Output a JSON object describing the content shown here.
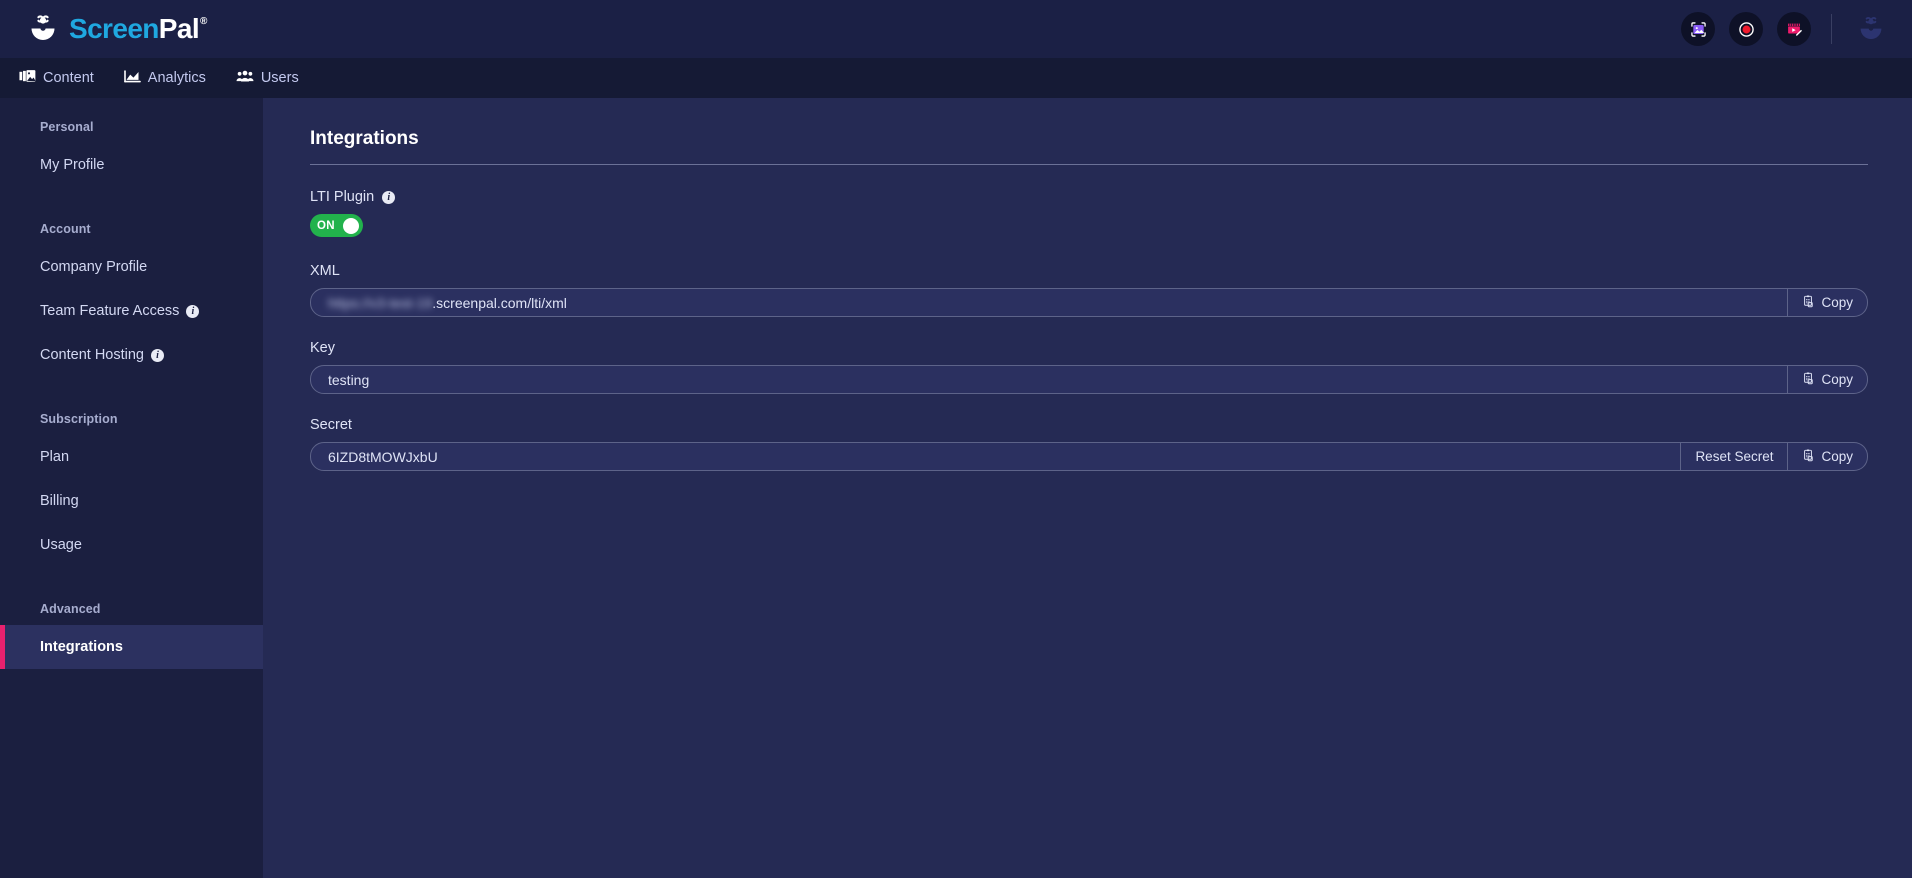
{
  "brand": {
    "logo_screen": "Screen",
    "logo_pal": "Pal",
    "logo_reg": "®",
    "accent_pink": "#e8216e",
    "accent_blue": "#1fa8e0",
    "toggle_green": "#22b24c"
  },
  "topbar": {
    "actions": [
      {
        "name": "screenshot-button",
        "icon": "image-capture-icon"
      },
      {
        "name": "record-button",
        "icon": "record-circle-icon"
      },
      {
        "name": "video-editor-button",
        "icon": "video-editor-icon"
      }
    ],
    "avatar_icon": "user-avatar-icon"
  },
  "nav": {
    "items": [
      {
        "label": "Content",
        "icon": "content-images-icon"
      },
      {
        "label": "Analytics",
        "icon": "analytics-chart-icon"
      },
      {
        "label": "Users",
        "icon": "users-group-icon"
      }
    ]
  },
  "sidebar": {
    "groups": [
      {
        "title": "Personal",
        "items": [
          {
            "label": "My Profile",
            "info": false,
            "active": false
          }
        ]
      },
      {
        "title": "Account",
        "items": [
          {
            "label": "Company Profile",
            "info": false,
            "active": false
          },
          {
            "label": "Team Feature Access",
            "info": true,
            "active": false
          },
          {
            "label": "Content Hosting",
            "info": true,
            "active": false
          }
        ]
      },
      {
        "title": "Subscription",
        "items": [
          {
            "label": "Plan",
            "info": false,
            "active": false
          },
          {
            "label": "Billing",
            "info": false,
            "active": false
          },
          {
            "label": "Usage",
            "info": false,
            "active": false
          }
        ]
      },
      {
        "title": "Advanced",
        "items": [
          {
            "label": "Integrations",
            "info": false,
            "active": true
          }
        ]
      }
    ],
    "info_glyph": "i"
  },
  "main": {
    "title": "Integrations",
    "lti": {
      "label": "LTI Plugin",
      "info_icon": "info-icon",
      "toggle_state": "ON",
      "toggle_on": true
    },
    "fields": [
      {
        "label": "XML",
        "value_redacted": "https://v3-test-19",
        "value": ".screenpal.com/lti/xml",
        "has_reset": false,
        "copy_label": "Copy"
      },
      {
        "label": "Key",
        "value_redacted": "",
        "value": "testing",
        "has_reset": false,
        "copy_label": "Copy"
      },
      {
        "label": "Secret",
        "value_redacted": "",
        "value": "6IZD8tMOWJxbU",
        "has_reset": true,
        "reset_label": "Reset Secret",
        "copy_label": "Copy"
      }
    ]
  }
}
